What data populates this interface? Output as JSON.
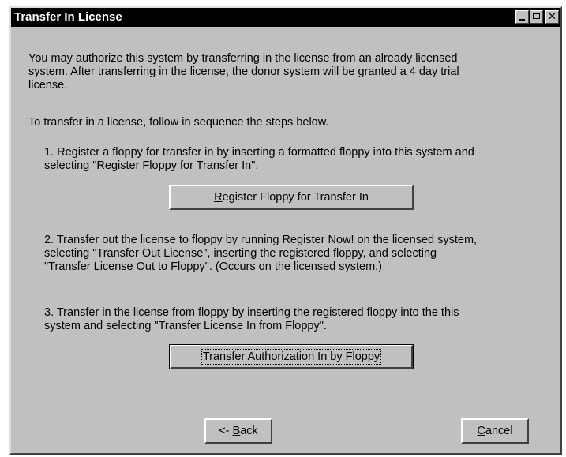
{
  "window": {
    "title": "Transfer In License"
  },
  "intro": {
    "line1": "You may authorize this system by transferring in the license from an already licensed",
    "line2": "system.  After transferring in the license, the donor system will be granted a 4 day trial",
    "line3": "license.",
    "sequence": "To transfer in a license, follow in sequence the steps below."
  },
  "steps": [
    {
      "line1": "1. Register a floppy for transfer in by inserting a formatted floppy into this system and",
      "line2": "selecting \"Register Floppy for Transfer In\"."
    },
    {
      "line1": "2. Transfer out the license to floppy by running Register Now! on the licensed system,",
      "line2": "selecting \"Transfer Out License\", inserting the registered floppy, and selecting",
      "line3": "\"Transfer License Out to Floppy\".  (Occurs on the licensed system.)"
    },
    {
      "line1": "3. Transfer in the license from floppy by inserting the registered floppy into the this",
      "line2": "system and selecting \"Transfer License In from Floppy\"."
    }
  ],
  "buttons": {
    "register": {
      "accel": "R",
      "rest": "egister Floppy for Transfer In"
    },
    "transfer": {
      "accel": "T",
      "rest": "ransfer Authorization In by Floppy"
    },
    "back": {
      "prefix": "<- ",
      "accel": "B",
      "rest": "ack"
    },
    "cancel": {
      "accel": "C",
      "rest": "ancel"
    }
  }
}
